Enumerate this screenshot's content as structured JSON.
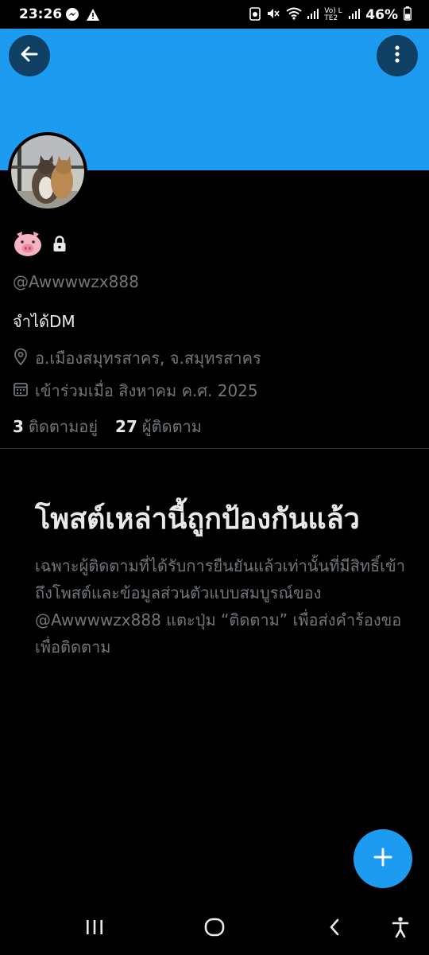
{
  "status_bar": {
    "time": "23:26",
    "battery": "46%",
    "network": "Vo) LTE2"
  },
  "profile": {
    "handle": "@Awwwwzx888",
    "bio": "จำได้DM",
    "location": "อ.เมืองสมุทรสาคร, จ.สมุทรสาคร",
    "joined": "เข้าร่วมเมื่อ สิงหาคม ค.ศ. 2025",
    "following_count": "3",
    "following_label": "ติดตามอยู่",
    "followers_count": "27",
    "followers_label": "ผู้ติดตาม"
  },
  "protected": {
    "title": "โพสต์เหล่านี้ถูกป้องกันแล้ว",
    "body": "เฉพาะผู้ติดตามที่ได้รับการยืนยันแล้วเท่านั้นที่มีสิทธิ์เข้าถึงโพสต์และข้อมูลส่วนตัวแบบสมบูรณ์ของ @Awwwwzx888 แตะปุ่ม “ติดตาม” เพื่อส่งคำร้องขอเพื่อติดตาม"
  },
  "icons": {
    "back": "arrow-left-icon",
    "more": "more-vertical-icon",
    "location": "location-pin-icon",
    "calendar": "calendar-icon",
    "compose": "plus-icon",
    "lock": "lock-icon",
    "name_emoji": "pig-face-icon"
  },
  "colors": {
    "accent": "#1d9bf0",
    "background": "#000000",
    "secondary_text": "#71767b"
  }
}
